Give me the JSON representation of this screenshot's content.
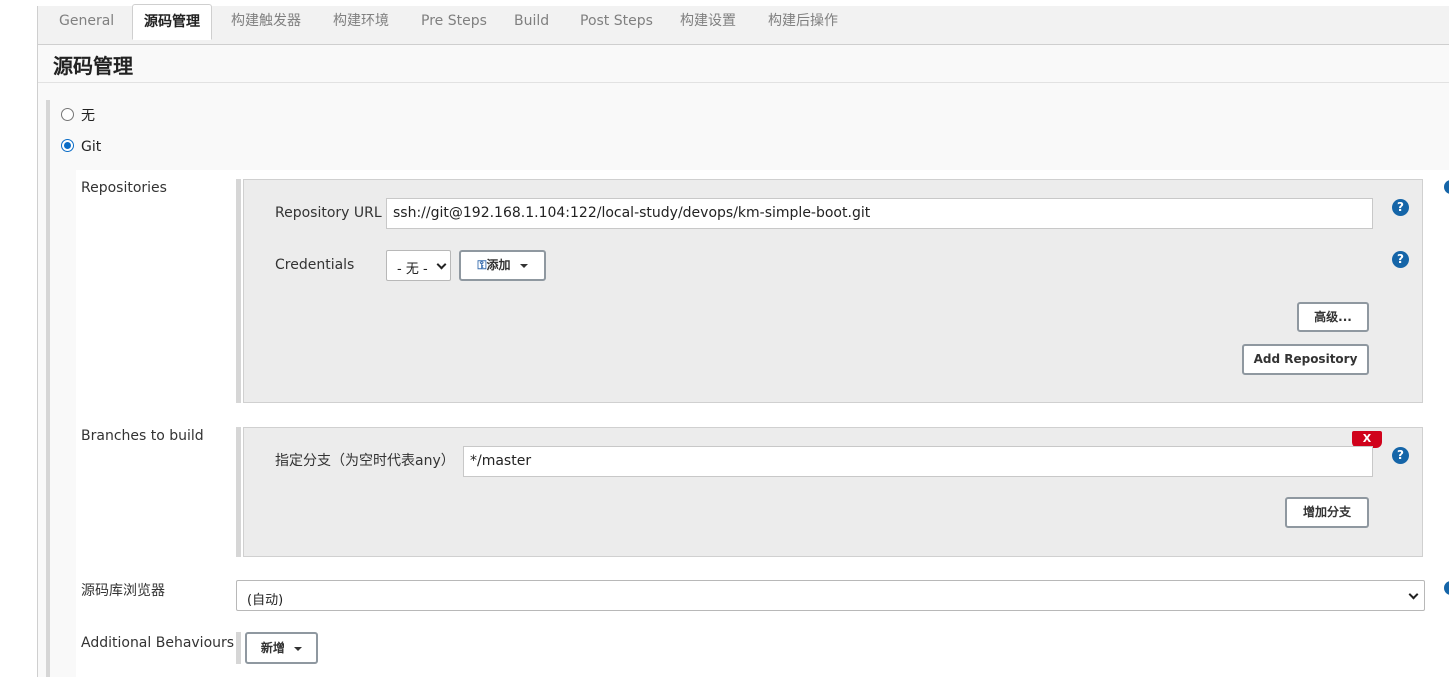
{
  "tabs": [
    {
      "label": "General",
      "active": false
    },
    {
      "label": "源码管理",
      "active": true
    },
    {
      "label": "构建触发器",
      "active": false
    },
    {
      "label": "构建环境",
      "active": false
    },
    {
      "label": "Pre Steps",
      "active": false
    },
    {
      "label": "Build",
      "active": false
    },
    {
      "label": "Post Steps",
      "active": false
    },
    {
      "label": "构建设置",
      "active": false
    },
    {
      "label": "构建后操作",
      "active": false
    }
  ],
  "section_title": "源码管理",
  "scm_options": [
    {
      "label": "无",
      "checked": false
    },
    {
      "label": "Git",
      "checked": true
    }
  ],
  "repositories": {
    "label": "Repositories",
    "url_label": "Repository URL",
    "url_value": "ssh://git@192.168.1.104:122/local-study/devops/km-simple-boot.git",
    "credentials_label": "Credentials",
    "credentials_selected": "- 无 -",
    "add_button": "添加",
    "advanced_button": "高级...",
    "add_repository_button": "Add Repository"
  },
  "branches": {
    "label": "Branches to build",
    "specifier_label": "指定分支（为空时代表any）",
    "specifier_value": "*/master",
    "delete_button": "X",
    "add_branch_button": "增加分支"
  },
  "repo_browser": {
    "label": "源码库浏览器",
    "selected": "(自动)"
  },
  "additional_behaviours": {
    "label": "Additional Behaviours",
    "add_button": "新增"
  },
  "help_glyph": "?",
  "icons": [
    "help-icon",
    "key-icon",
    "caret-down-icon",
    "chevron-down-icon"
  ],
  "colors": {
    "accent": "#1565a8",
    "radio": "#0b6dc7",
    "delete": "#d0021b",
    "panel": "#ececec"
  }
}
